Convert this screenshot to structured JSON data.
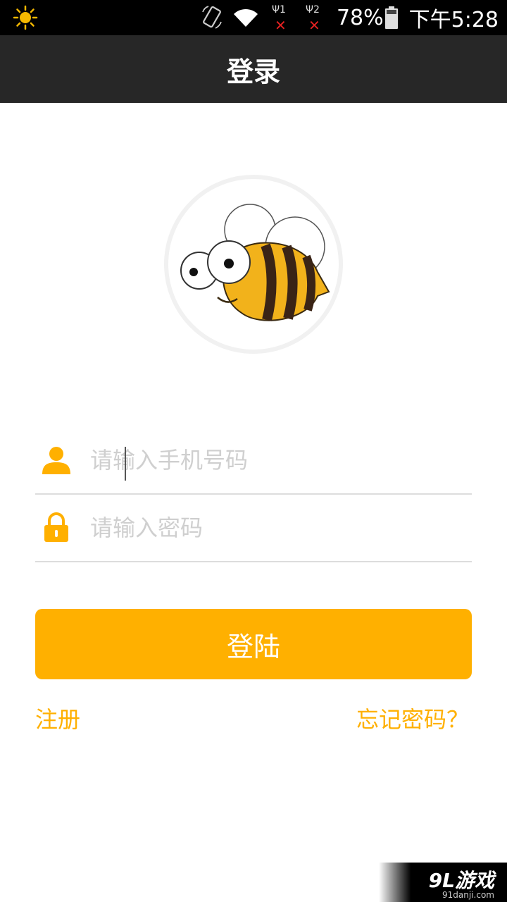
{
  "status_bar": {
    "brightness_icon": "sun-icon",
    "rotation_icon": "screen-rotation-icon",
    "wifi_icon": "wifi-icon",
    "sim1_label": "Ψ1",
    "sim2_label": "Ψ2",
    "battery_percent": "78%",
    "time": "下午5:28"
  },
  "app_bar": {
    "title": "登录"
  },
  "logo": {
    "icon": "bee-logo-icon"
  },
  "form": {
    "phone": {
      "placeholder": "请输入手机号码",
      "value": "",
      "icon": "user-icon"
    },
    "password": {
      "placeholder": "请输入密码",
      "value": "",
      "icon": "lock-icon"
    },
    "login_label": "登陆"
  },
  "links": {
    "register": "注册",
    "forgot_password": "忘记密码？"
  },
  "watermark": {
    "main": "9L游戏",
    "sub": "91danji.com"
  },
  "colors": {
    "accent": "#FFB000",
    "app_bar": "#272727",
    "status_bar": "#000000"
  }
}
